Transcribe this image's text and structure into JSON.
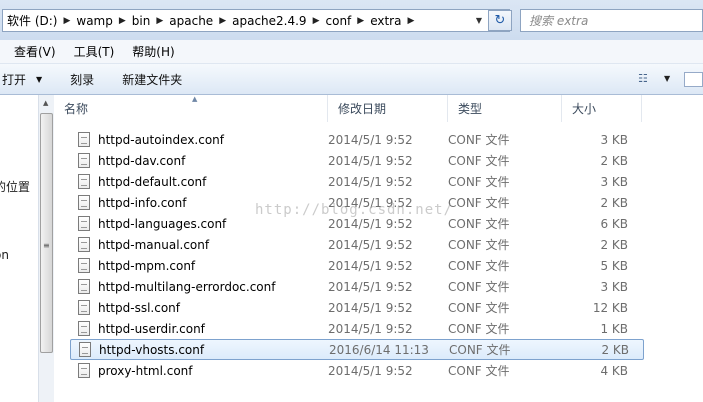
{
  "address": {
    "crumbs": [
      "软件 (D:)",
      "wamp",
      "bin",
      "apache",
      "apache2.4.9",
      "conf",
      "extra"
    ],
    "search_placeholder": "搜索 extra"
  },
  "menu": [
    "查看(V)",
    "工具(T)",
    "帮助(H)"
  ],
  "toolbar": {
    "open": "打开",
    "burn": "刻录",
    "new_folder": "新建文件夹"
  },
  "nav": {
    "item1": "的位置",
    "item2": "on"
  },
  "columns": {
    "name": "名称",
    "date": "修改日期",
    "type": "类型",
    "size": "大小"
  },
  "files": [
    {
      "name": "httpd-autoindex.conf",
      "date": "2014/5/1 9:52",
      "type": "CONF 文件",
      "size": "3 KB"
    },
    {
      "name": "httpd-dav.conf",
      "date": "2014/5/1 9:52",
      "type": "CONF 文件",
      "size": "2 KB"
    },
    {
      "name": "httpd-default.conf",
      "date": "2014/5/1 9:52",
      "type": "CONF 文件",
      "size": "3 KB"
    },
    {
      "name": "httpd-info.conf",
      "date": "2014/5/1 9:52",
      "type": "CONF 文件",
      "size": "2 KB"
    },
    {
      "name": "httpd-languages.conf",
      "date": "2014/5/1 9:52",
      "type": "CONF 文件",
      "size": "6 KB"
    },
    {
      "name": "httpd-manual.conf",
      "date": "2014/5/1 9:52",
      "type": "CONF 文件",
      "size": "2 KB"
    },
    {
      "name": "httpd-mpm.conf",
      "date": "2014/5/1 9:52",
      "type": "CONF 文件",
      "size": "5 KB"
    },
    {
      "name": "httpd-multilang-errordoc.conf",
      "date": "2014/5/1 9:52",
      "type": "CONF 文件",
      "size": "3 KB"
    },
    {
      "name": "httpd-ssl.conf",
      "date": "2014/5/1 9:52",
      "type": "CONF 文件",
      "size": "12 KB"
    },
    {
      "name": "httpd-userdir.conf",
      "date": "2014/5/1 9:52",
      "type": "CONF 文件",
      "size": "1 KB"
    },
    {
      "name": "httpd-vhosts.conf",
      "date": "2016/6/14 11:13",
      "type": "CONF 文件",
      "size": "2 KB",
      "selected": true
    },
    {
      "name": "proxy-html.conf",
      "date": "2014/5/1 9:52",
      "type": "CONF 文件",
      "size": "4 KB"
    }
  ],
  "watermark": "http://blog.csdn.net/"
}
